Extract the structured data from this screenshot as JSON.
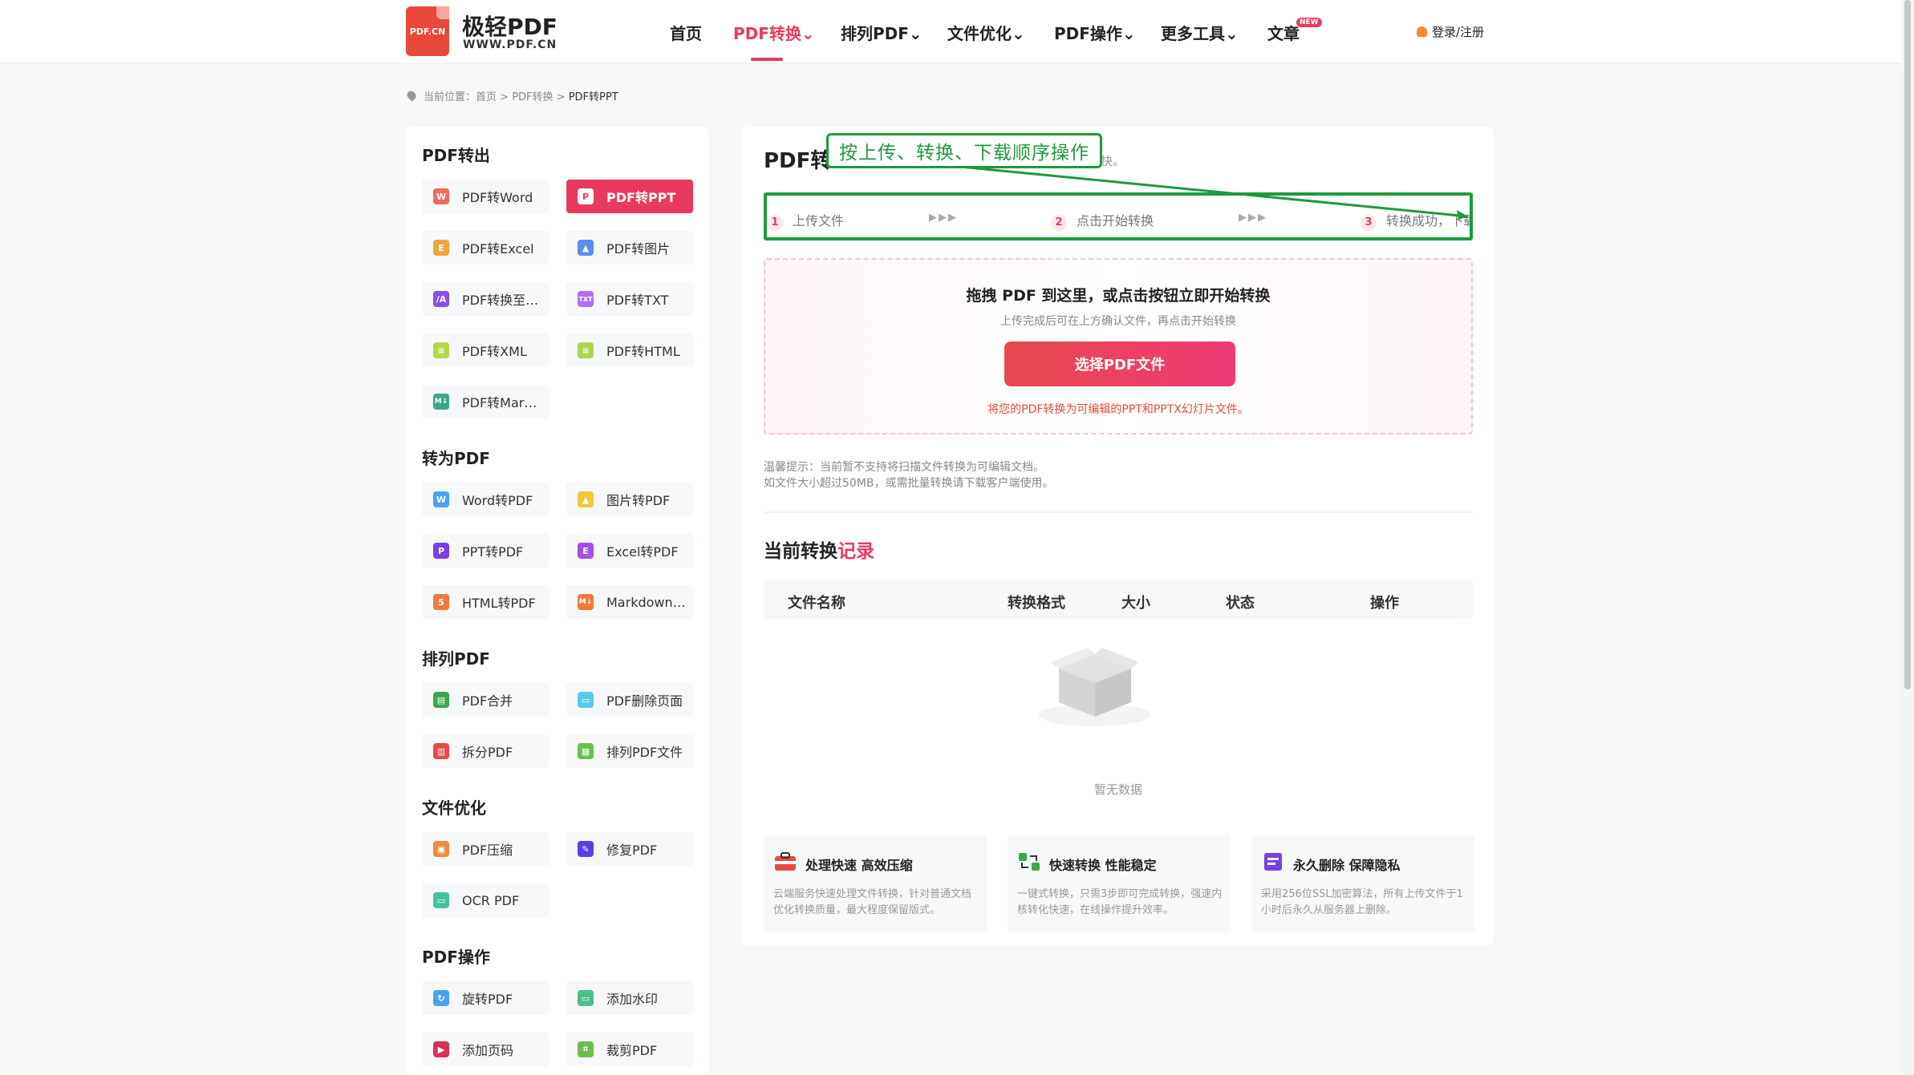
{
  "brand": {
    "logo_text": "PDF.CN",
    "name": "极轻PDF",
    "domain": "WWW.PDF.CN"
  },
  "nav": [
    {
      "label": "首页"
    },
    {
      "label": "PDF转换⌄"
    },
    {
      "label": "排列PDF⌄"
    },
    {
      "label": "文件优化⌄"
    },
    {
      "label": "PDF操作⌄"
    },
    {
      "label": "更多工具⌄"
    },
    {
      "label": "文章"
    }
  ],
  "nav_badge": "NEW",
  "login": "登录/注册",
  "breadcrumb": {
    "prefix": "当前位置：",
    "home": "首页",
    "sep1": " > ",
    "section": "PDF转换",
    "sep2": " > ",
    "current": "PDF转PPT"
  },
  "sidebar": {
    "sections": [
      {
        "title": "PDF转出",
        "items": [
          "PDF转Word",
          "PDF转PPT",
          "PDF转Excel",
          "PDF转图片",
          "PDF转换至…",
          "PDF转TXT",
          "PDF转XML",
          "PDF转HTML",
          "PDF转Mar…"
        ]
      },
      {
        "title": "转为PDF",
        "items": [
          "Word转PDF",
          "图片转PDF",
          "PPT转PDF",
          "Excel转PDF",
          "HTML转PDF",
          "Markdown…"
        ]
      },
      {
        "title": "排列PDF",
        "items": [
          "PDF合并",
          "PDF删除页面",
          "拆分PDF",
          "排列PDF文件"
        ]
      },
      {
        "title": "文件优化",
        "items": [
          "PDF压缩",
          "修复PDF",
          "OCR PDF"
        ]
      },
      {
        "title": "PDF操作",
        "items": [
          "旋转PDF",
          "添加水印",
          "添加页码",
          "裁剪PDF"
        ]
      }
    ],
    "icon_letters": {
      "word": "W",
      "ppt": "P",
      "excel": "E",
      "txt": "TXT",
      "md": "M↓"
    }
  },
  "main": {
    "title": "PDF转",
    "subtitle_tail": "快。",
    "callout": "按上传、转换、下载顺序操作",
    "steps": [
      {
        "num": "1",
        "label": "上传文件"
      },
      {
        "num": "2",
        "label": "点击开始转换"
      },
      {
        "num": "3",
        "label": "转换成功，下载"
      }
    ],
    "arrows": "▶▶▶",
    "drop": {
      "title": "拖拽 PDF 到这里，或点击按钮立即开始转换",
      "subtitle": "上传完成后可在上方确认文件，再点击开始转换",
      "button": "选择PDF文件",
      "note": "将您的PDF转换为可编辑的PPT和PPTX幻灯片文件。"
    },
    "tips": [
      "温馨提示：当前暂不支持将扫描文件转换为可编辑文档。",
      "如文件大小超过50MB，或需批量转换请下载客户端使用。"
    ],
    "records": {
      "title_prefix": "当前转换",
      "title_highlight": "记录",
      "columns": [
        "文件名称",
        "转换格式",
        "大小",
        "状态",
        "操作"
      ],
      "empty": "暂无数据"
    },
    "features": [
      {
        "title": "处理快速 高效压缩",
        "desc": "云端服务快速处理文件转换，针对普通文档优化转换质量，最大程度保留版式。"
      },
      {
        "title": "快速转换 性能稳定",
        "desc": "一键式转换，只需3步即可完成转换，强速内核转化快速，在线操作提升效率。"
      },
      {
        "title": "永久删除 保障隐私",
        "desc": "采用256位SSL加密算法，所有上传文件于1小时后永久从服务器上删除。"
      }
    ]
  },
  "colors": {
    "accent": "#e83a5e",
    "annotation_green": "#1d9a3f"
  }
}
